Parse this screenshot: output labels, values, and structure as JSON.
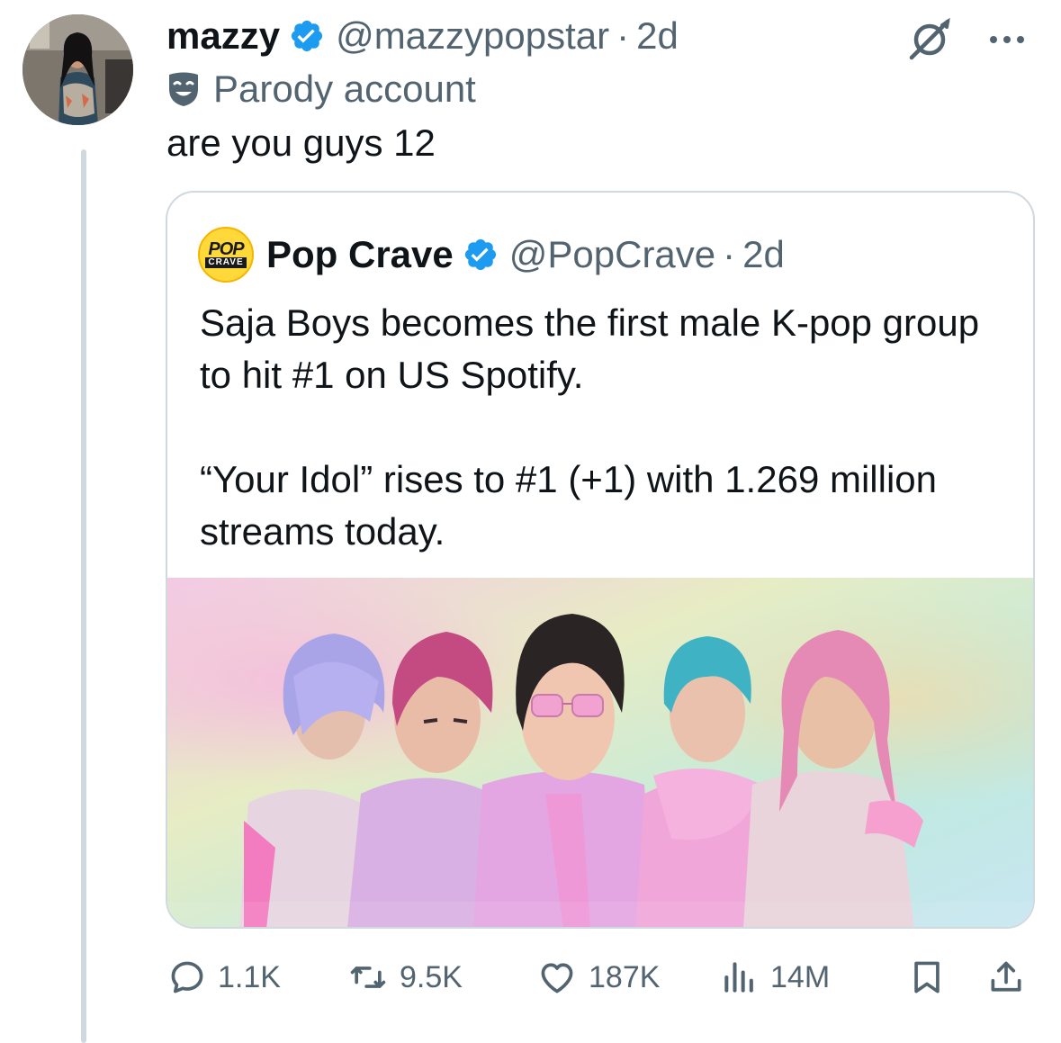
{
  "tweet": {
    "author": {
      "display_name": "mazzy",
      "handle": "@mazzypopstar",
      "separator": "·",
      "time": "2d",
      "verified": true,
      "label": "Parody account",
      "avatar_icon": "person-photo"
    },
    "text": "are you guys 12"
  },
  "quote": {
    "author": {
      "display_name": "Pop Crave",
      "handle": "@PopCrave",
      "separator": "·",
      "time": "2d",
      "verified": true,
      "avatar_logo_top": "POP",
      "avatar_logo_bottom": "CRAVE"
    },
    "text_paragraphs": [
      "Saja Boys becomes the first male K-pop group to hit #1 on US Spotify.",
      "“Your Idol” rises to #1 (+1) with 1.269 million streams today."
    ],
    "media": {
      "icon": "animated-boy-band-image"
    }
  },
  "actions": {
    "reply_count": "1.1K",
    "repost_count": "9.5K",
    "like_count": "187K",
    "views_count": "14M"
  },
  "colors": {
    "text_primary": "#0f1419",
    "text_secondary": "#536471",
    "verified_blue": "#1d9bf0",
    "border": "#cfd9de"
  }
}
